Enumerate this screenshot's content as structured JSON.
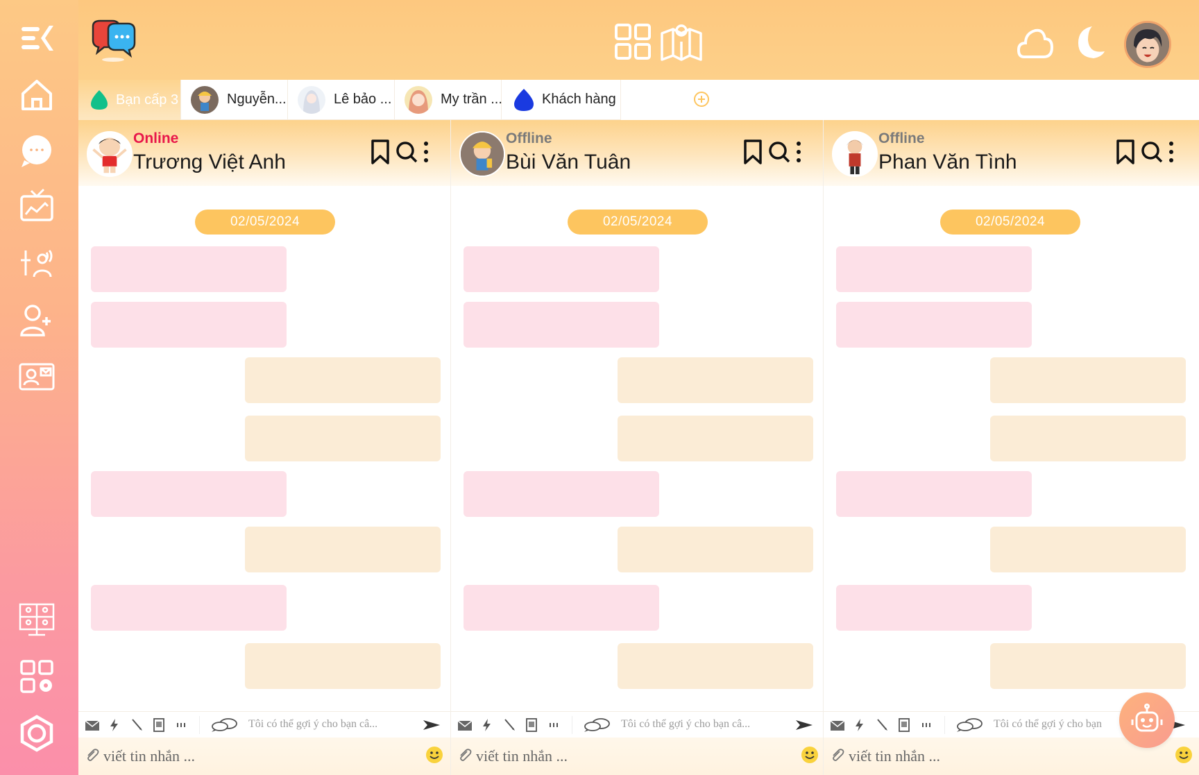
{
  "colors": {
    "accent": "#fdc55f",
    "online": "#e8174a",
    "offline": "#7a7a7a",
    "incoming_bubble": "#fde0e8",
    "outgoing_bubble": "#fbecd6"
  },
  "header": {
    "icons": [
      "app-logo-icon",
      "grid-icon",
      "map-icon",
      "cloud-icon",
      "moon-icon",
      "user-avatar"
    ]
  },
  "sidebar": {
    "items": [
      {
        "icon": "menu-collapse-icon"
      },
      {
        "icon": "home-icon"
      },
      {
        "icon": "chat-bubble-icon"
      },
      {
        "icon": "tv-chart-icon"
      },
      {
        "icon": "voice-settings-icon"
      },
      {
        "icon": "add-user-icon"
      },
      {
        "icon": "contact-card-icon"
      },
      {
        "icon": "video-meeting-icon"
      },
      {
        "icon": "apps-settings-icon"
      },
      {
        "icon": "hexagon-logo-icon"
      }
    ]
  },
  "tabs": [
    {
      "label": "Bạn cấp 3",
      "active": true
    },
    {
      "label": "Nguyễn...",
      "active": false
    },
    {
      "label": "Lê bảo ...",
      "active": false
    },
    {
      "label": "My trần ...",
      "active": false
    },
    {
      "label": "Khách hàng",
      "active": false
    }
  ],
  "panels": [
    {
      "status": "Online",
      "name": "Trương Việt Anh",
      "date": "02/05/2024",
      "suggestion": "Tôi có thể gợi ý cho bạn câ...",
      "input_placeholder": "viết tin nhắn ..."
    },
    {
      "status": "Offline",
      "name": "Bùi Văn Tuân",
      "date": "02/05/2024",
      "suggestion": "Tôi có thể gợi ý cho bạn câ...",
      "input_placeholder": "viết tin nhắn ..."
    },
    {
      "status": "Offline",
      "name": "Phan Văn Tình",
      "date": "02/05/2024",
      "suggestion": "Tôi có thể gợi ý cho bạn",
      "input_placeholder": "viết tin nhắn ..."
    }
  ]
}
